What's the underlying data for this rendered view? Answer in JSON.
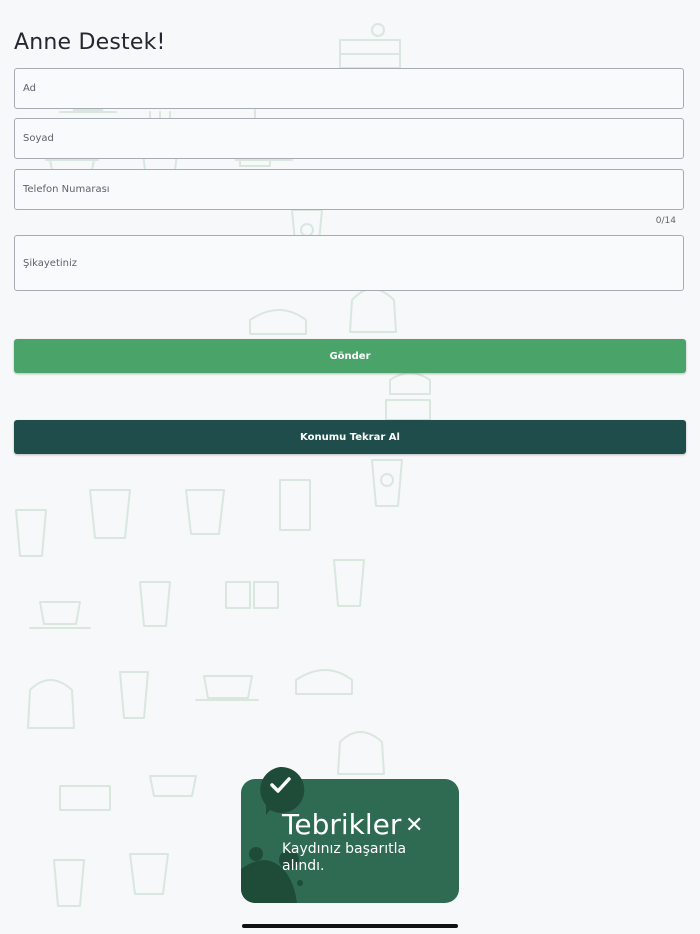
{
  "page": {
    "title": "Anne Destek!"
  },
  "form": {
    "first_name_placeholder": "Ad",
    "last_name_placeholder": "Soyad",
    "phone_placeholder": "Telefon Numarası",
    "phone_counter": "0/14",
    "complaint_placeholder": "Şikayetiniz"
  },
  "buttons": {
    "send_label": "Gönder",
    "relocate_label": "Konumu Tekrar Al"
  },
  "toast": {
    "title": "Tebrikler",
    "message": "Kaydınız başarıtla alındı.",
    "icon": "check-icon",
    "close_icon": "close-icon"
  },
  "colors": {
    "send_button": "#4aa46a",
    "relocate_button": "#1e4d4b",
    "toast_bg": "#2f6b52",
    "toast_dark": "#1f4b39"
  }
}
